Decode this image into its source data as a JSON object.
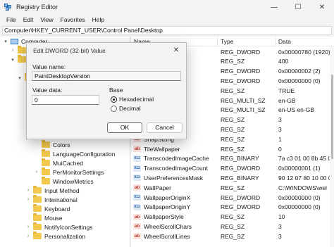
{
  "window": {
    "title": "Registry Editor"
  },
  "window_controls": {
    "minimize": "—",
    "maximize": "☐",
    "close": "✕"
  },
  "menu": [
    "File",
    "Edit",
    "View",
    "Favorites",
    "Help"
  ],
  "address": "Computer\\HKEY_CURRENT_USER\\Control Panel\\Desktop",
  "tree": {
    "root": "Computer",
    "items": [
      {
        "label": "Colors",
        "level": 3
      },
      {
        "label": "LanguageConfiguration",
        "level": 3
      },
      {
        "label": "MuiCached",
        "level": 3
      },
      {
        "label": "PerMonitorSettings",
        "level": 3,
        "expandable": true
      },
      {
        "label": "WindowMetrics",
        "level": 3
      },
      {
        "label": "Input Method",
        "level": 2,
        "expandable": true
      },
      {
        "label": "International",
        "level": 2,
        "expandable": true
      },
      {
        "label": "Keyboard",
        "level": 2
      },
      {
        "label": "Mouse",
        "level": 2
      },
      {
        "label": "NotifyIconSettings",
        "level": 2,
        "expandable": true
      },
      {
        "label": "Personalization",
        "level": 2,
        "expandable": true
      }
    ]
  },
  "list": {
    "columns": [
      "Name",
      "Type",
      "Data"
    ],
    "rows": [
      {
        "name": "...pDimensi...",
        "type": "REG_DWORD",
        "data": "0x00000780 (1920)",
        "icon": "bin"
      },
      {
        "name": "...",
        "type": "REG_SZ",
        "data": "400",
        "icon": "ab"
      },
      {
        "name": "...ing",
        "type": "REG_DWORD",
        "data": "0x00000002 (2)",
        "icon": "bin"
      },
      {
        "name": "...on",
        "type": "REG_DWORD",
        "data": "0x00000000 (0)",
        "icon": "bin"
      },
      {
        "name": "...",
        "type": "REG_SZ",
        "data": "TRUE",
        "icon": "ab"
      },
      {
        "name": "...ages",
        "type": "REG_MULTI_SZ",
        "data": "en-GB",
        "icon": "ab"
      },
      {
        "name": "...UILangua...",
        "type": "REG_MULTI_SZ",
        "data": "en-US en-GB",
        "icon": "ab"
      },
      {
        "name": "...s",
        "type": "REG_SZ",
        "data": "3",
        "icon": "ab"
      },
      {
        "name": "...",
        "type": "REG_SZ",
        "data": "3",
        "icon": "ab"
      },
      {
        "name": "SnapSizing",
        "type": "REG_SZ",
        "data": "1",
        "icon": "ab"
      },
      {
        "name": "TileWallpaper",
        "type": "REG_SZ",
        "data": "0",
        "icon": "ab"
      },
      {
        "name": "TranscodedImageCache",
        "type": "REG_BINARY",
        "data": "7a c3 01 00 8b 45 0",
        "icon": "bin"
      },
      {
        "name": "TranscodedImageCount",
        "type": "REG_DWORD",
        "data": "0x00000001 (1)",
        "icon": "bin"
      },
      {
        "name": "UserPreferencesMask",
        "type": "REG_BINARY",
        "data": "90 12 07 80 10 00 0",
        "icon": "bin"
      },
      {
        "name": "WallPaper",
        "type": "REG_SZ",
        "data": "C:\\WINDOWS\\wel",
        "icon": "ab"
      },
      {
        "name": "WallpaperOriginX",
        "type": "REG_DWORD",
        "data": "0x00000000 (0)",
        "icon": "bin"
      },
      {
        "name": "WallpaperOriginY",
        "type": "REG_DWORD",
        "data": "0x00000000 (0)",
        "icon": "bin"
      },
      {
        "name": "WallpaperStyle",
        "type": "REG_SZ",
        "data": "10",
        "icon": "ab"
      },
      {
        "name": "WheelScrollChars",
        "type": "REG_SZ",
        "data": "3",
        "icon": "ab"
      },
      {
        "name": "WheelScrollLines",
        "type": "REG_SZ",
        "data": "3",
        "icon": "ab"
      }
    ]
  },
  "dialog": {
    "title": "Edit DWORD (32-bit) Value",
    "value_name_label": "Value name:",
    "value_name": "PaintDesktopVersion",
    "value_data_label": "Value data:",
    "value_data": "0",
    "base_label": "Base",
    "base_options": [
      "Hexadecimal",
      "Decimal"
    ],
    "base_selected": "Hexadecimal",
    "ok_label": "OK",
    "cancel_label": "Cancel",
    "close_glyph": "✕"
  }
}
